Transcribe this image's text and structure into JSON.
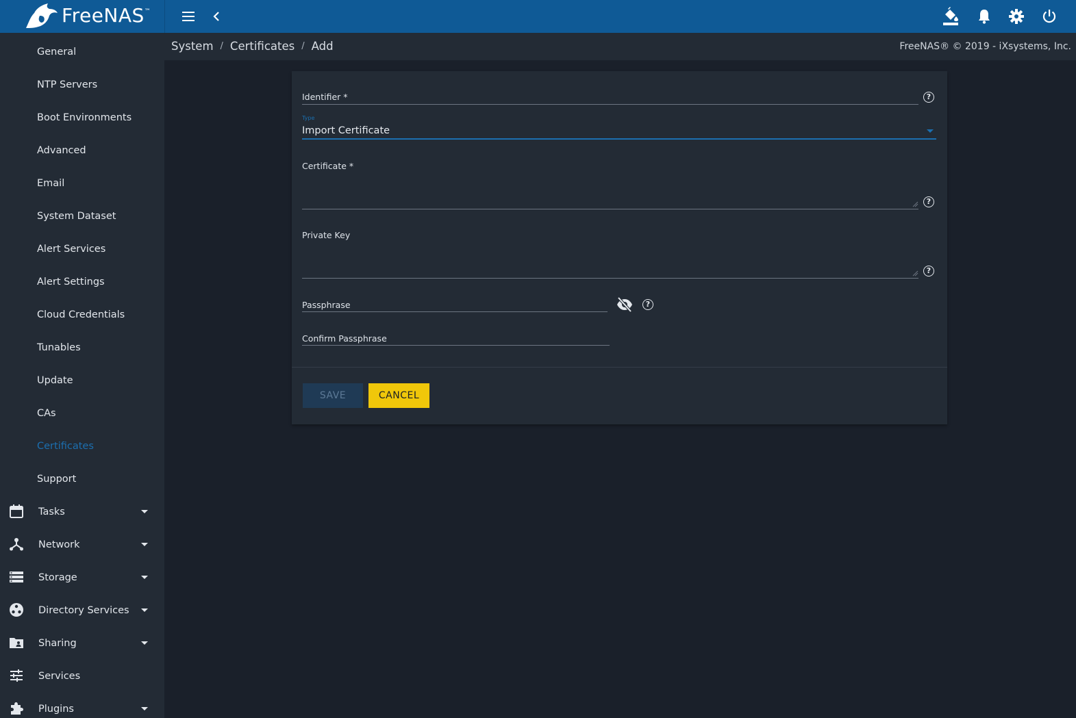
{
  "header": {
    "brand": "FreeNAS",
    "brand_mark": "™",
    "icons": [
      "menu-icon",
      "back-chevron-icon",
      "theme-paint-bucket-icon",
      "notifications-bell-icon",
      "settings-gear-icon",
      "power-icon"
    ]
  },
  "sidebar": {
    "items": [
      {
        "label": "General"
      },
      {
        "label": "NTP Servers"
      },
      {
        "label": "Boot Environments"
      },
      {
        "label": "Advanced"
      },
      {
        "label": "Email"
      },
      {
        "label": "System Dataset"
      },
      {
        "label": "Alert Services"
      },
      {
        "label": "Alert Settings"
      },
      {
        "label": "Cloud Credentials"
      },
      {
        "label": "Tunables"
      },
      {
        "label": "Update"
      },
      {
        "label": "CAs"
      },
      {
        "label": "Certificates",
        "active": true
      },
      {
        "label": "Support"
      }
    ],
    "sections": [
      {
        "label": "Tasks",
        "icon": "calendar-icon"
      },
      {
        "label": "Network",
        "icon": "network-icon"
      },
      {
        "label": "Storage",
        "icon": "storage-icon"
      },
      {
        "label": "Directory Services",
        "icon": "directory-services-icon"
      },
      {
        "label": "Sharing",
        "icon": "sharing-folder-icon"
      },
      {
        "label": "Services",
        "icon": "services-tune-icon"
      },
      {
        "label": "Plugins",
        "icon": "plugins-puzzle-icon"
      }
    ]
  },
  "breadcrumb": {
    "items": [
      "System",
      "Certificates",
      "Add"
    ],
    "separator": "/"
  },
  "copyright": "FreeNAS® © 2019 - iXsystems, Inc.",
  "form": {
    "identifier_label": "Identifier *",
    "identifier_value": "",
    "type_label": "Type",
    "type_value": "Import Certificate",
    "certificate_label": "Certificate *",
    "certificate_value": "",
    "private_key_label": "Private Key",
    "private_key_value": "",
    "passphrase_label": "Passphrase",
    "confirm_passphrase_label": "Confirm Passphrase",
    "help_glyph": "?",
    "save_label": "SAVE",
    "cancel_label": "CANCEL"
  },
  "colors": {
    "topbar": "#0f5a96",
    "sidebar": "#232b35",
    "background": "#1a202a",
    "accent": "#1b6fb0",
    "cancel_button": "#f0c70a",
    "save_button_disabled": "#1f3a55"
  }
}
